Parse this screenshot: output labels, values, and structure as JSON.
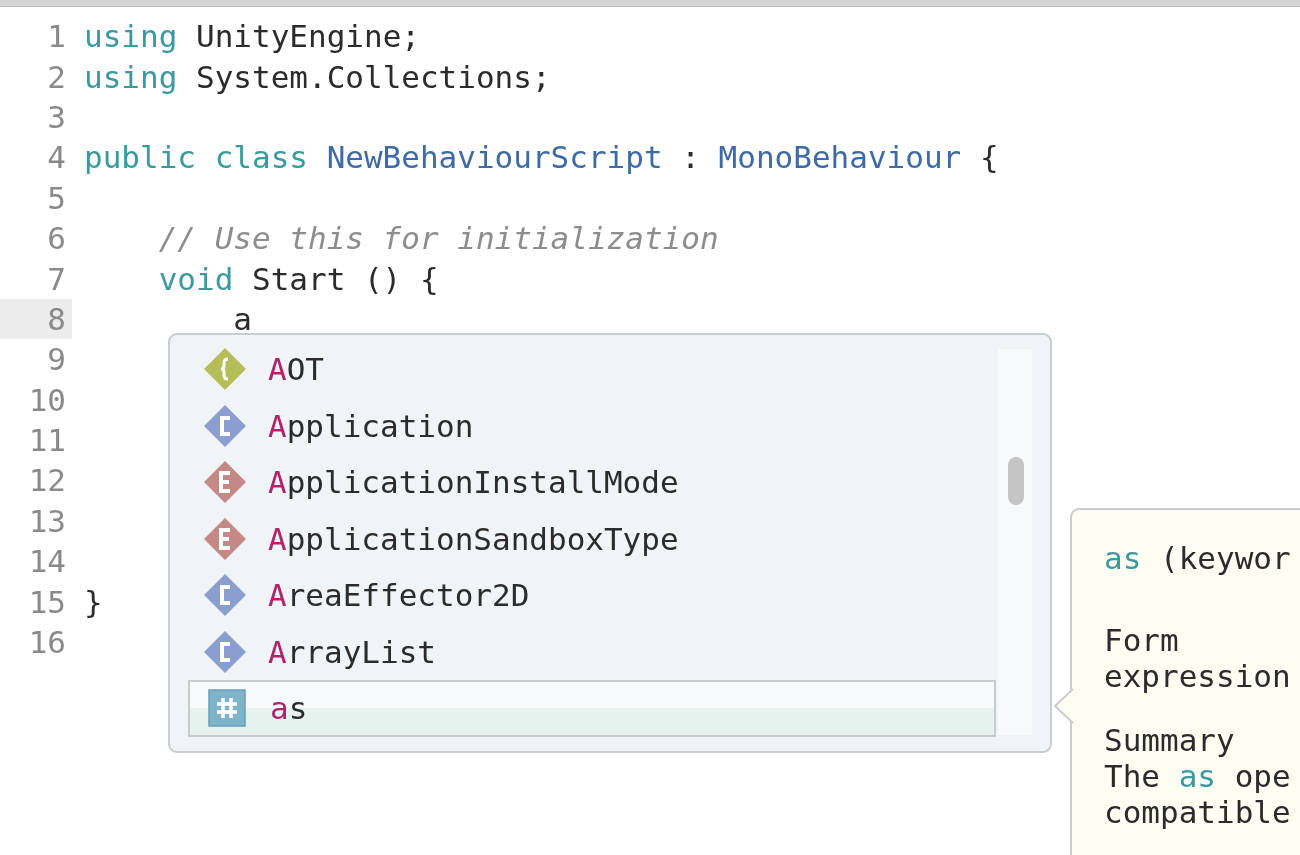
{
  "editor": {
    "lines": [
      {
        "number": "1",
        "current": false,
        "tokens": [
          {
            "kind": "keyword",
            "text": "using"
          },
          {
            "kind": "plain",
            "text": " UnityEngine;"
          }
        ]
      },
      {
        "number": "2",
        "current": false,
        "tokens": [
          {
            "kind": "keyword",
            "text": "using"
          },
          {
            "kind": "plain",
            "text": " System.Collections;"
          }
        ]
      },
      {
        "number": "3",
        "current": false
      },
      {
        "number": "4",
        "current": false,
        "tokens": [
          {
            "kind": "keyword",
            "text": "public class"
          },
          {
            "kind": "type",
            "text": " NewBehaviourScript"
          },
          {
            "kind": "plain",
            "text": " : "
          },
          {
            "kind": "type",
            "text": "MonoBehaviour"
          },
          {
            "kind": "plain",
            "text": " {"
          }
        ]
      },
      {
        "number": "5",
        "current": false
      },
      {
        "number": "6",
        "current": false,
        "tokens": [
          {
            "kind": "comment",
            "text": "    // Use this for initialization"
          }
        ]
      },
      {
        "number": "7",
        "current": false,
        "tokens": [
          {
            "kind": "keyword",
            "text": "    void"
          },
          {
            "kind": "plain",
            "text": " Start () {"
          }
        ]
      },
      {
        "number": "8",
        "current": true,
        "tokens": [
          {
            "kind": "plain",
            "text": "        a"
          }
        ]
      },
      {
        "number": "9",
        "current": false
      },
      {
        "number": "10",
        "current": false
      },
      {
        "number": "11",
        "current": false
      },
      {
        "number": "12",
        "current": false
      },
      {
        "number": "13",
        "current": false
      },
      {
        "number": "14",
        "current": false
      },
      {
        "number": "15",
        "current": false,
        "tokens": [
          {
            "kind": "plain",
            "text": "}"
          }
        ]
      },
      {
        "number": "16",
        "current": false
      }
    ]
  },
  "completion": {
    "items": [
      {
        "kind": "namespace",
        "match": "A",
        "rest": "OT",
        "selected": false
      },
      {
        "kind": "class",
        "match": "A",
        "rest": "pplication",
        "selected": false
      },
      {
        "kind": "enum",
        "match": "A",
        "rest": "pplicationInstallMode",
        "selected": false
      },
      {
        "kind": "enum",
        "match": "A",
        "rest": "pplicationSandboxType",
        "selected": false
      },
      {
        "kind": "class",
        "match": "A",
        "rest": "reaEffector2D",
        "selected": false
      },
      {
        "kind": "class",
        "match": "A",
        "rest": "rrayList",
        "selected": false
      },
      {
        "kind": "keyword",
        "match": "a",
        "rest": "s",
        "selected": true
      }
    ]
  },
  "tooltip": {
    "title": [
      {
        "kind": "keyword",
        "text": "as"
      },
      {
        "kind": "plain",
        "text": " (keywor"
      }
    ],
    "paragraphs": [
      {
        "lines": [
          [
            {
              "kind": "plain",
              "text": "Form"
            }
          ],
          [
            {
              "kind": "plain",
              "text": "expression"
            }
          ]
        ]
      },
      {
        "lines": [
          [
            {
              "kind": "plain",
              "text": "Summary"
            }
          ],
          [
            {
              "kind": "plain",
              "text": "The "
            },
            {
              "kind": "keyword",
              "text": "as"
            },
            {
              "kind": "plain",
              "text": " ope"
            }
          ],
          [
            {
              "kind": "plain",
              "text": "compatible"
            }
          ]
        ]
      }
    ]
  }
}
